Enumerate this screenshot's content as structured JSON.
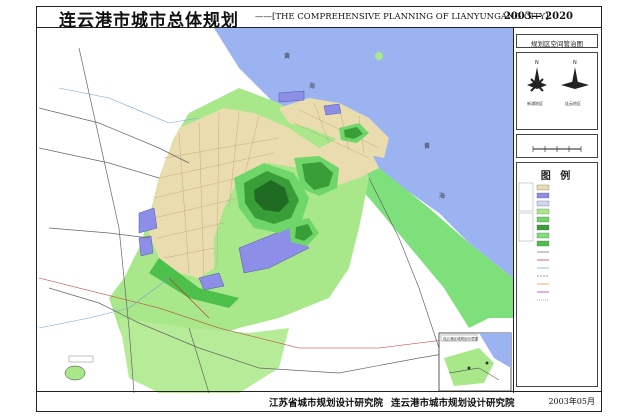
{
  "header": {
    "title_cn": "连云港市城市总体规划",
    "title_en": "——[THE COMPREHENSIVE PLANNING OF LIANYUNGANG CITY]",
    "years": "2003— 2020"
  },
  "map": {
    "sea_char_1": "黄",
    "sea_char_2": "海",
    "sea_char_3": "黄",
    "sea_char_4": "海",
    "inset_label": "连云港区域规划示意图"
  },
  "side_panel": {
    "control_map_title": "规划区空间管治图",
    "compass_left_caption": "新浦地区",
    "compass_right_caption": "连云地区",
    "legend_title": "图 例"
  },
  "footer": {
    "org_1": "江苏省城市规划设计研究院",
    "org_2": "连云港市城市规划设计研究院",
    "date": "2003年05月"
  },
  "colors": {
    "sea": "#9bb3f0",
    "built_up": "#e9dcae",
    "green_light": "#a9e88a",
    "green_mid": "#6fd66a",
    "mountain": "#3a9e38",
    "industrial": "#8d8ee8",
    "coast_green": "#7ee07a"
  }
}
